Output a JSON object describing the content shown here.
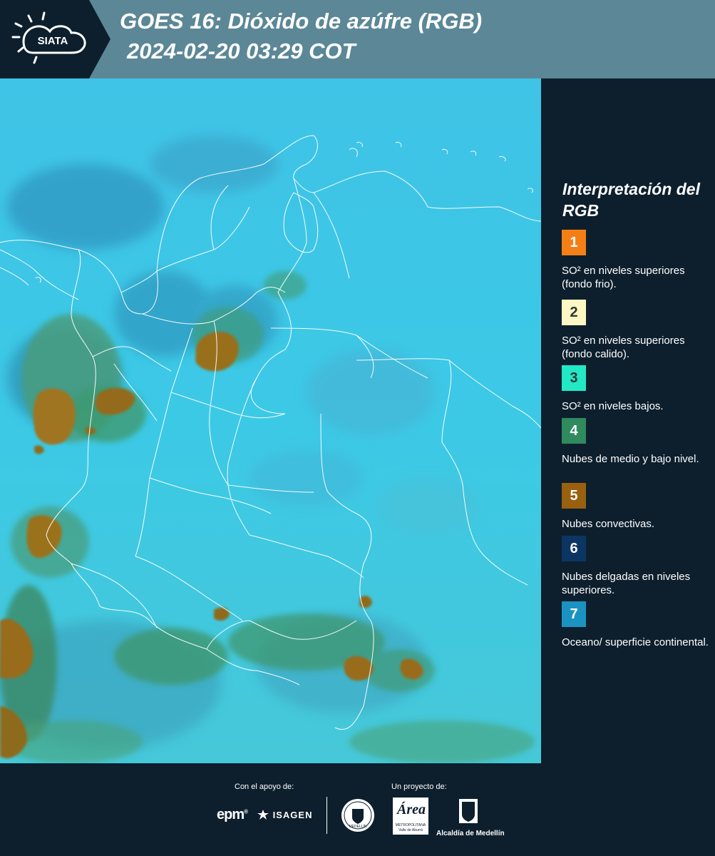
{
  "header": {
    "logo_text": "SIATA",
    "title_line1": "GOES 16: Dióxido de azúfre (RGB)",
    "title_line2": "2024-02-20 03:29 COT"
  },
  "legend": {
    "title": "Interpretación del RGB",
    "items": [
      {
        "number": "1",
        "label": "SO² en niveles superiores (fondo frio).",
        "color": "#f57f17",
        "text_color": "#ffffff"
      },
      {
        "number": "2",
        "label": "SO² en niveles superiores (fondo calido).",
        "color": "#fdf7c3",
        "text_color": "#333333"
      },
      {
        "number": "3",
        "label": "SO² en niveles bajos.",
        "color": "#22e8c6",
        "text_color": "#333333"
      },
      {
        "number": "4",
        "label": "Nubes de medio y bajo nivel.",
        "color": "#2f8a5e",
        "text_color": "#ffffff"
      },
      {
        "number": "5",
        "label": "Nubes convectivas.",
        "color": "#98600f",
        "text_color": "#ffffff"
      },
      {
        "number": "6",
        "label": "Nubes delgadas en niveles superiores.",
        "color": "#0b3563",
        "text_color": "#ffffff"
      },
      {
        "number": "7",
        "label": "Oceano/ superficie continental.",
        "color": "#1b93c2",
        "text_color": "#ffffff"
      }
    ]
  },
  "footer": {
    "support_caption": "Con el apoyo de:",
    "project_caption": "Un proyecto de:",
    "epm_text": "epm",
    "isagen_text": "ISAGEN",
    "area_text": "Área",
    "area_sub": "METROPOLITANA",
    "area_sub2": "Valle de Aburrá",
    "seal_text": "MEDELLÍN",
    "alcaldia_text": "Alcaldía de Medellín"
  },
  "colors": {
    "header_bg": "#5b8797",
    "panel_bg": "#0d1f2d",
    "ocean": "#35c6e3",
    "convective": "#98600f",
    "midlow": "#2f8a5e"
  }
}
